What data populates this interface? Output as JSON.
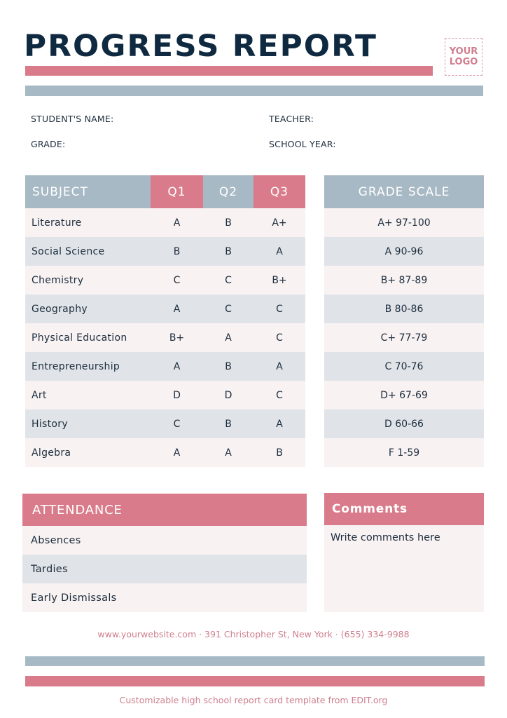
{
  "header": {
    "title": "PROGRESS REPORT",
    "logo_line1": "YOUR",
    "logo_line2": "LOGO"
  },
  "info": {
    "student_name_label": "STUDENT'S NAME:",
    "teacher_label": "TEACHER:",
    "grade_label": "GRADE:",
    "school_year_label": "SCHOOL YEAR:"
  },
  "grades_table": {
    "columns": [
      "SUBJECT",
      "Q1",
      "Q2",
      "Q3"
    ],
    "rows": [
      {
        "subject": "Literature",
        "q1": "A",
        "q2": "B",
        "q3": "A+"
      },
      {
        "subject": "Social Science",
        "q1": "B",
        "q2": "B",
        "q3": "A"
      },
      {
        "subject": "Chemistry",
        "q1": "C",
        "q2": "C",
        "q3": "B+"
      },
      {
        "subject": "Geography",
        "q1": "A",
        "q2": "C",
        "q3": "C"
      },
      {
        "subject": "Physical Education",
        "q1": "B+",
        "q2": "A",
        "q3": "C"
      },
      {
        "subject": "Entrepreneurship",
        "q1": "A",
        "q2": "B",
        "q3": "A"
      },
      {
        "subject": "Art",
        "q1": "D",
        "q2": "D",
        "q3": "C"
      },
      {
        "subject": "History",
        "q1": "C",
        "q2": "B",
        "q3": "A"
      },
      {
        "subject": "Algebra",
        "q1": "A",
        "q2": "A",
        "q3": "B"
      }
    ]
  },
  "grade_scale": {
    "title": "GRADE SCALE",
    "items": [
      "A+ 97-100",
      "A 90-96",
      "B+ 87-89",
      "B 80-86",
      "C+ 77-79",
      "C 70-76",
      "D+ 67-69",
      "D 60-66",
      "F 1-59"
    ]
  },
  "attendance": {
    "title": "ATTENDANCE",
    "items": [
      "Absences",
      "Tardies",
      "Early Dismissals"
    ]
  },
  "comments": {
    "title": "Comments",
    "placeholder": "Write comments here"
  },
  "footer": {
    "contact": "www.yourwebsite.com · 391 Christopher St, New York · (655) 334-9988",
    "credit": "Customizable high school report card template from EDIT.org"
  },
  "colors": {
    "navy": "#0f2a40",
    "pink": "#d97b8a",
    "blue_gray": "#a7b9c5",
    "row_light": "#f8f2f2",
    "row_gray": "#e0e4e8"
  }
}
